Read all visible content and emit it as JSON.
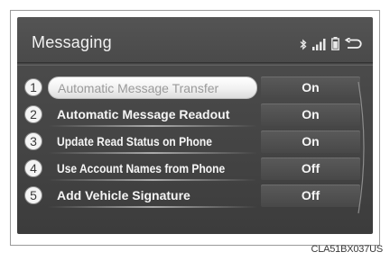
{
  "screen": {
    "title": "Messaging",
    "status_icons": [
      "bluetooth-icon",
      "signal-icon",
      "battery-icon",
      "back-icon"
    ]
  },
  "items": [
    {
      "number": "1",
      "label": "Automatic Message Transfer",
      "value": "On",
      "selected": true
    },
    {
      "number": "2",
      "label": "Automatic Message Readout",
      "value": "On",
      "selected": false
    },
    {
      "number": "3",
      "label": "Update Read Status on Phone",
      "value": "On",
      "selected": false
    },
    {
      "number": "4",
      "label": "Use Account Names from Phone",
      "value": "Off",
      "selected": false
    },
    {
      "number": "5",
      "label": "Add Vehicle Signature",
      "value": "Off",
      "selected": false
    }
  ],
  "caption": "CLA51BX037US",
  "colors": {
    "screen_background": "#474747",
    "text": "#f5f5f5",
    "selected_button": "#f1f1f1",
    "selected_text": "#9a9a9a"
  }
}
